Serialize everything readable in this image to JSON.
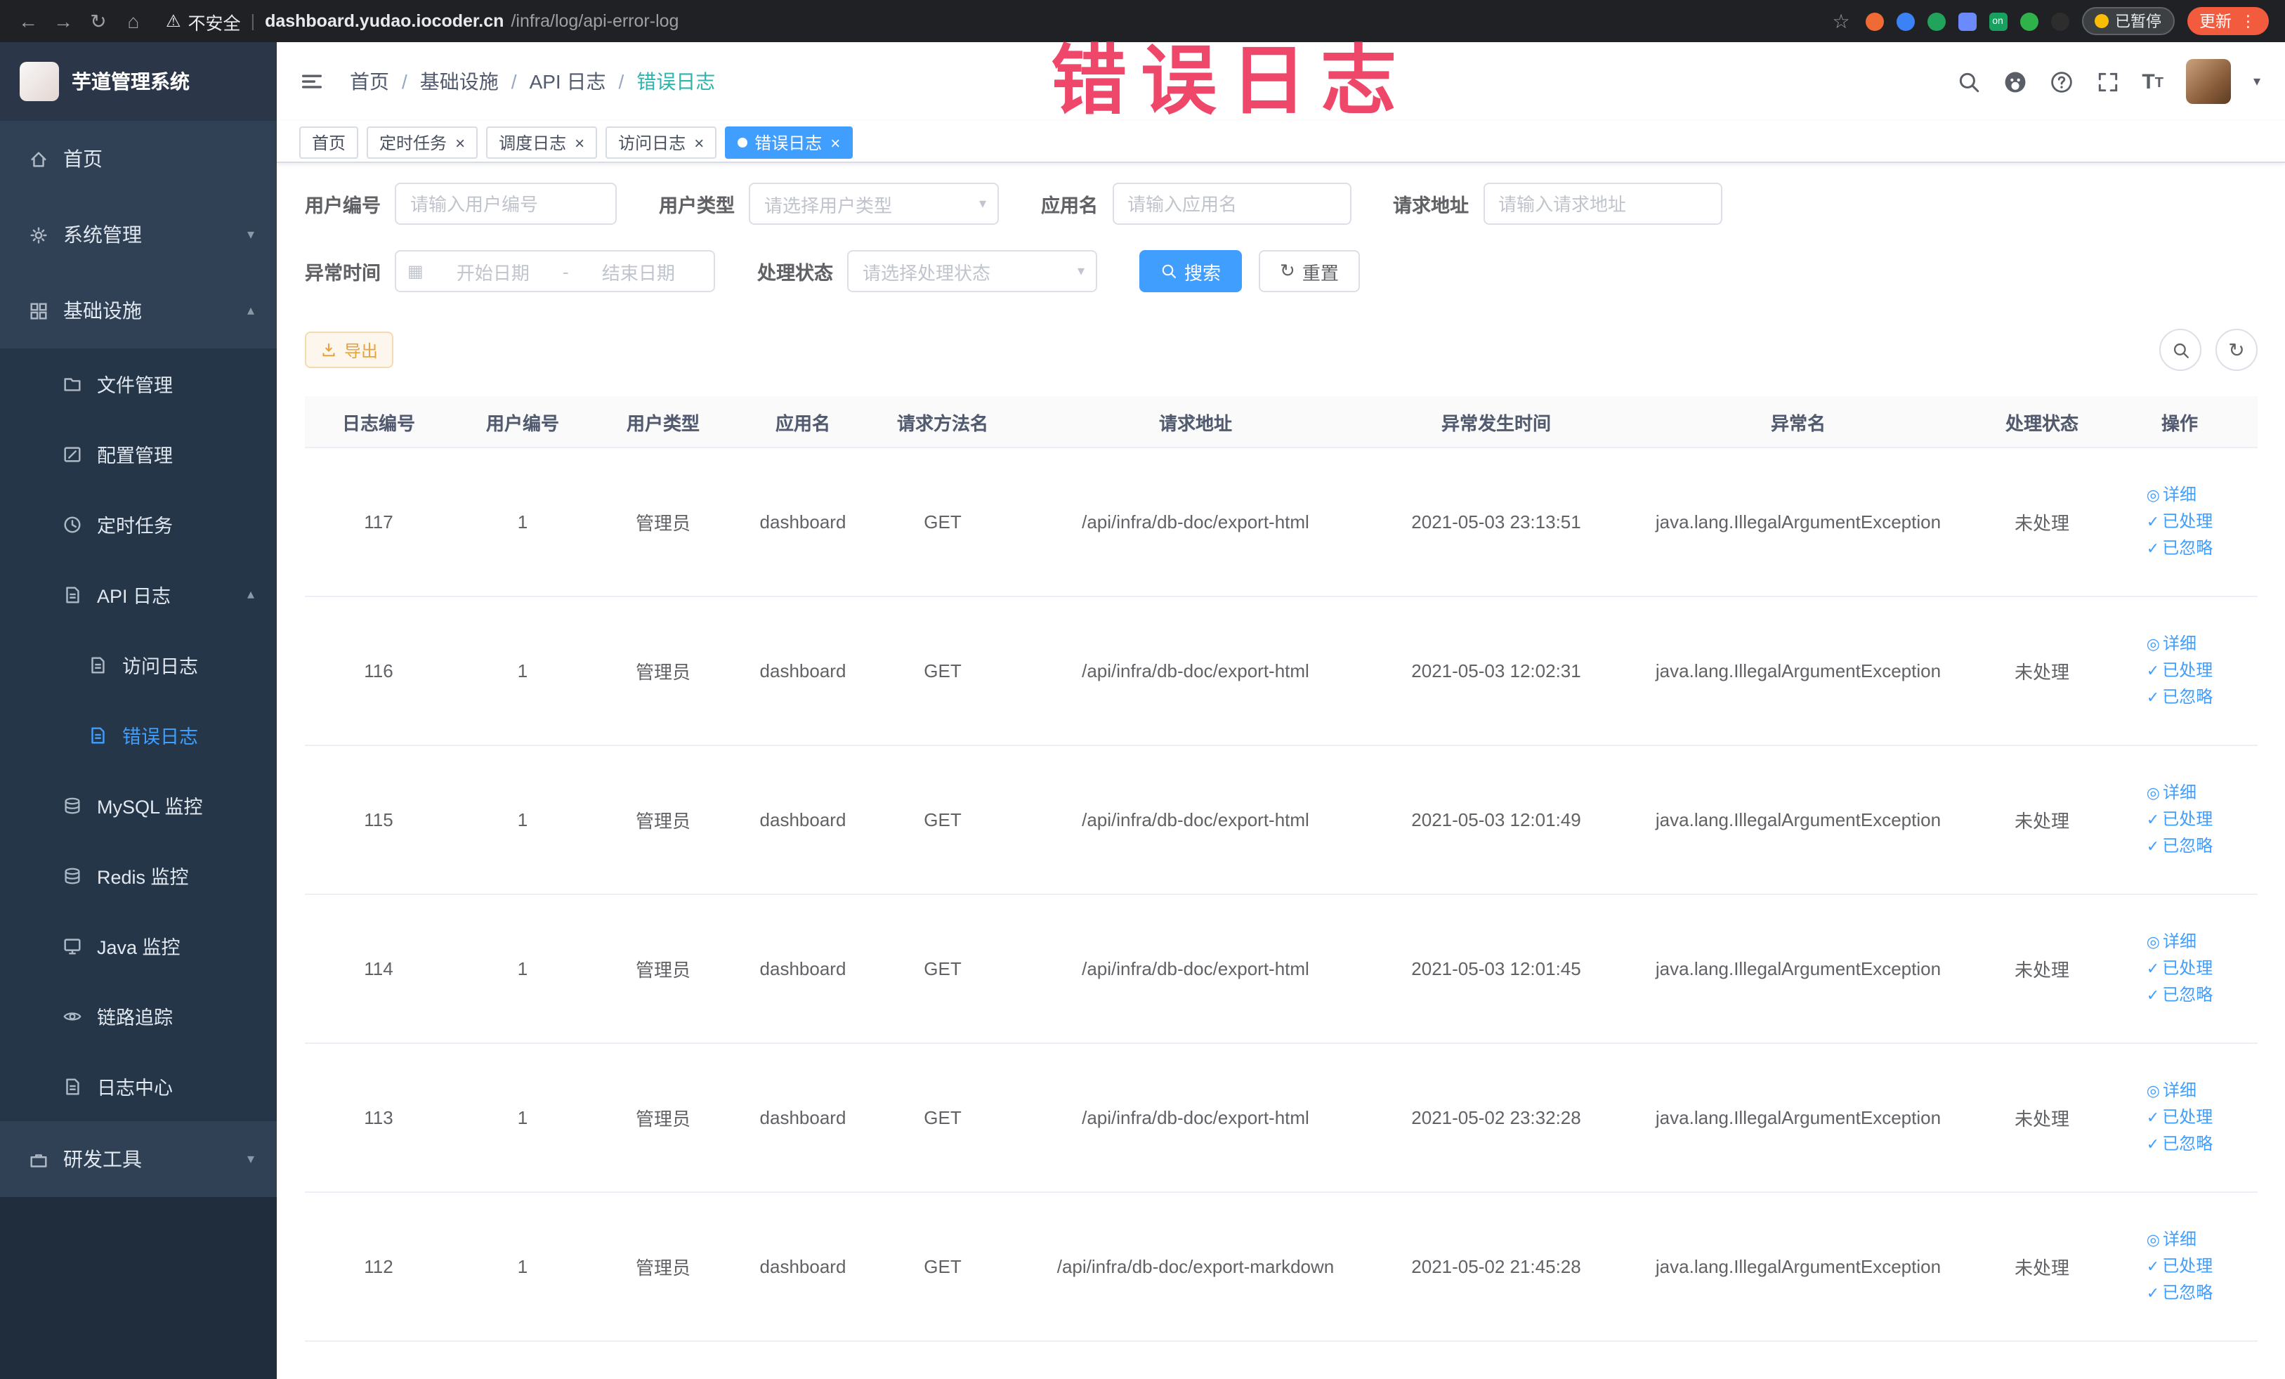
{
  "theme": {
    "primary": "#409eff",
    "warning": "#e6a23c",
    "sidebar_bg": "#304156",
    "submenu_bg": "#1f2d3d",
    "annotation_red": "#ee3a5f",
    "active_tab_bg": "#409eff"
  },
  "icons": {
    "back": "←",
    "forward": "→",
    "reload": "↻",
    "home": "⌂",
    "warning": "⚠",
    "divider": "|",
    "star": "☆",
    "more": "⋮",
    "slash": "/",
    "chevron_down": "▾",
    "chevron_up": "▴",
    "close": "×",
    "check": "✓",
    "eye": "◎",
    "refresh": "↻",
    "calendar": "▦",
    "font_size": "T",
    "on_badge": "on"
  },
  "browser": {
    "security_label": "不安全",
    "url_domain": "dashboard.yudao.iocoder.cn",
    "url_path": "/infra/log/api-error-log",
    "paused_badge": "已暂停",
    "update_button": "更新"
  },
  "annotation_text": "错误日志",
  "sidebar": {
    "logo_title": "芋道管理系统",
    "home": "首页",
    "system": "系统管理",
    "infra": "基础设施",
    "file": "文件管理",
    "config": "配置管理",
    "job": "定时任务",
    "api_log": "API 日志",
    "access_log": "访问日志",
    "error_log": "错误日志",
    "mysql": "MySQL 监控",
    "redis": "Redis 监控",
    "java": "Java 监控",
    "trace": "链路追踪",
    "log_center": "日志中心",
    "devtools": "研发工具"
  },
  "breadcrumb": {
    "items": [
      "首页",
      "基础设施",
      "API 日志",
      "错误日志"
    ]
  },
  "tabs": [
    {
      "label": "首页"
    },
    {
      "label": "定时任务"
    },
    {
      "label": "调度日志"
    },
    {
      "label": "访问日志"
    },
    {
      "label": "错误日志"
    }
  ],
  "filters": {
    "user_id": {
      "label": "用户编号",
      "placeholder": "请输入用户编号"
    },
    "user_type": {
      "label": "用户类型",
      "placeholder": "请选择用户类型"
    },
    "app_name": {
      "label": "应用名",
      "placeholder": "请输入应用名"
    },
    "request_url": {
      "label": "请求地址",
      "placeholder": "请输入请求地址"
    },
    "exception_time": {
      "label": "异常时间",
      "start_placeholder": "开始日期",
      "separator": "-",
      "end_placeholder": "结束日期"
    },
    "process_status": {
      "label": "处理状态",
      "placeholder": "请选择处理状态"
    },
    "search_button": "搜索",
    "reset_button": "重置"
  },
  "toolbar": {
    "export_label": "导出"
  },
  "table": {
    "columns": [
      "日志编号",
      "用户编号",
      "用户类型",
      "应用名",
      "请求方法名",
      "请求地址",
      "异常发生时间",
      "异常名",
      "处理状态",
      "操作"
    ],
    "actions": {
      "detail": "详细",
      "processed": "已处理",
      "ignored": "已忽略"
    },
    "rows": [
      {
        "id": "117",
        "user_id": "1",
        "user_type": "管理员",
        "app_name": "dashboard",
        "method": "GET",
        "url": "/api/infra/db-doc/export-html",
        "time": "2021-05-03 23:13:51",
        "exception": "java.lang.IllegalArgumentException",
        "status": "未处理"
      },
      {
        "id": "116",
        "user_id": "1",
        "user_type": "管理员",
        "app_name": "dashboard",
        "method": "GET",
        "url": "/api/infra/db-doc/export-html",
        "time": "2021-05-03 12:02:31",
        "exception": "java.lang.IllegalArgumentException",
        "status": "未处理"
      },
      {
        "id": "115",
        "user_id": "1",
        "user_type": "管理员",
        "app_name": "dashboard",
        "method": "GET",
        "url": "/api/infra/db-doc/export-html",
        "time": "2021-05-03 12:01:49",
        "exception": "java.lang.IllegalArgumentException",
        "status": "未处理"
      },
      {
        "id": "114",
        "user_id": "1",
        "user_type": "管理员",
        "app_name": "dashboard",
        "method": "GET",
        "url": "/api/infra/db-doc/export-html",
        "time": "2021-05-03 12:01:45",
        "exception": "java.lang.IllegalArgumentException",
        "status": "未处理"
      },
      {
        "id": "113",
        "user_id": "1",
        "user_type": "管理员",
        "app_name": "dashboard",
        "method": "GET",
        "url": "/api/infra/db-doc/export-html",
        "time": "2021-05-02 23:32:28",
        "exception": "java.lang.IllegalArgumentException",
        "status": "未处理"
      },
      {
        "id": "112",
        "user_id": "1",
        "user_type": "管理员",
        "app_name": "dashboard",
        "method": "GET",
        "url": "/api/infra/db-doc/export-markdown",
        "time": "2021-05-02 21:45:28",
        "exception": "java.lang.IllegalArgumentException",
        "status": "未处理"
      }
    ]
  }
}
